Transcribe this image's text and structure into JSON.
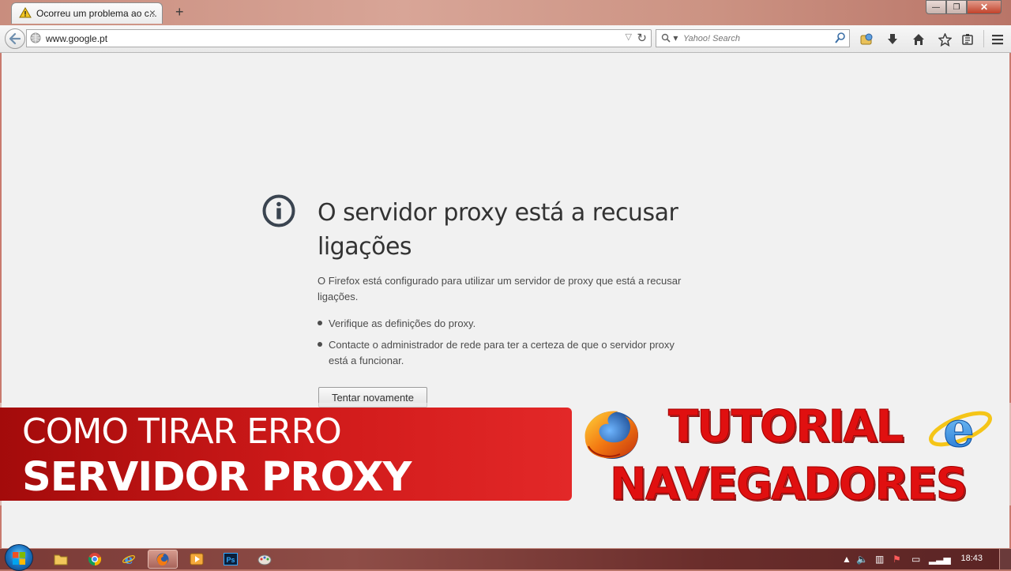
{
  "window": {
    "tab_title": "Ocorreu um problema ao c...",
    "tab_close": "×",
    "new_tab": "+",
    "minimize": "—",
    "maximize": "❐",
    "close": "✕"
  },
  "navbar": {
    "url": "www.google.pt",
    "search_placeholder": "Yahoo! Search",
    "url_dropdown": "▽",
    "reload": "↻",
    "search_engine_arrow": "▾",
    "icons": [
      "back-icon",
      "globe-icon",
      "reload-icon",
      "yahoo-icon",
      "magnifier-icon",
      "bookmark-manager-icon",
      "download-icon",
      "home-icon",
      "star-icon",
      "reading-list-icon",
      "hamburger-menu-icon"
    ]
  },
  "error_page": {
    "title": "O servidor proxy está a recusar ligações",
    "description": "O Firefox está configurado para utilizar um servidor de proxy que está a recusar ligações.",
    "bullets": [
      "Verifique as definições do proxy.",
      "Contacte o administrador de rede para ter a certeza de que o servidor proxy está a funcionar."
    ],
    "retry_button": "Tentar novamente"
  },
  "overlay": {
    "line1": "COMO TIRAR ERRO",
    "line2": "SERVIDOR PROXY",
    "tutorial": "TUTORIAL",
    "browsers": "NAVEGADORES",
    "logos": [
      "firefox-logo",
      "internet-explorer-logo"
    ],
    "banner_color": "#d01a1a",
    "title_color": "#e01010"
  },
  "taskbar": {
    "apps": [
      "windows-explorer-icon",
      "chrome-icon",
      "internet-explorer-icon",
      "firefox-icon",
      "media-player-icon",
      "photoshop-icon",
      "paint-icon"
    ],
    "photoshop_label": "Ps",
    "clock": "18:43"
  }
}
